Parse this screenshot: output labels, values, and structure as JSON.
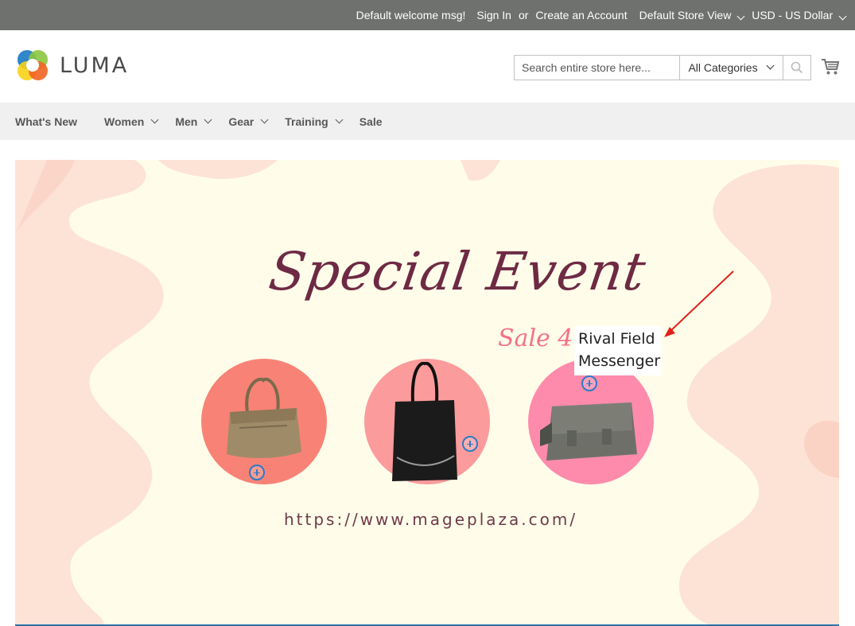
{
  "topbar": {
    "welcome": "Default welcome msg!",
    "sign_in": "Sign In",
    "or": "or",
    "create_account": "Create an Account",
    "store_view": "Default Store View",
    "currency": "USD - US Dollar"
  },
  "header": {
    "logo_text": "LUMA",
    "search_placeholder": "Search entire store here...",
    "category_selected": "All Categories"
  },
  "nav": {
    "items": [
      {
        "label": "What's New",
        "has_dropdown": false
      },
      {
        "label": "Women",
        "has_dropdown": true
      },
      {
        "label": "Men",
        "has_dropdown": true
      },
      {
        "label": "Gear",
        "has_dropdown": true
      },
      {
        "label": "Training",
        "has_dropdown": true
      },
      {
        "label": "Sale",
        "has_dropdown": false
      }
    ]
  },
  "banner": {
    "title": "Special Event",
    "sale_text": "Sale 4",
    "url": "https://www.mageplaza.com/",
    "tooltip": "Rival Field Messenger",
    "colors": {
      "background": "#fffde9",
      "title": "#6e2a44",
      "sale": "#f46f8a",
      "hotspot": "#2a7bc8"
    }
  },
  "icons": [
    "luma-logo-icon",
    "search-icon",
    "cart-icon",
    "chevron-down-icon",
    "plus-circle-icon",
    "arrow-icon"
  ]
}
